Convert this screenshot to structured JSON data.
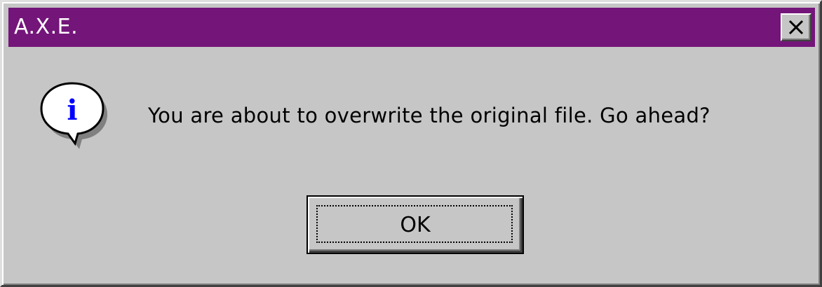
{
  "window": {
    "title": "A.X.E.",
    "titlebar_color": "#74157a",
    "close_icon": "close-icon"
  },
  "dialog": {
    "icon": "info-icon",
    "icon_glyph": "i",
    "message": "You are about to overwrite the original file.  Go ahead?",
    "ok_label": "OK"
  }
}
